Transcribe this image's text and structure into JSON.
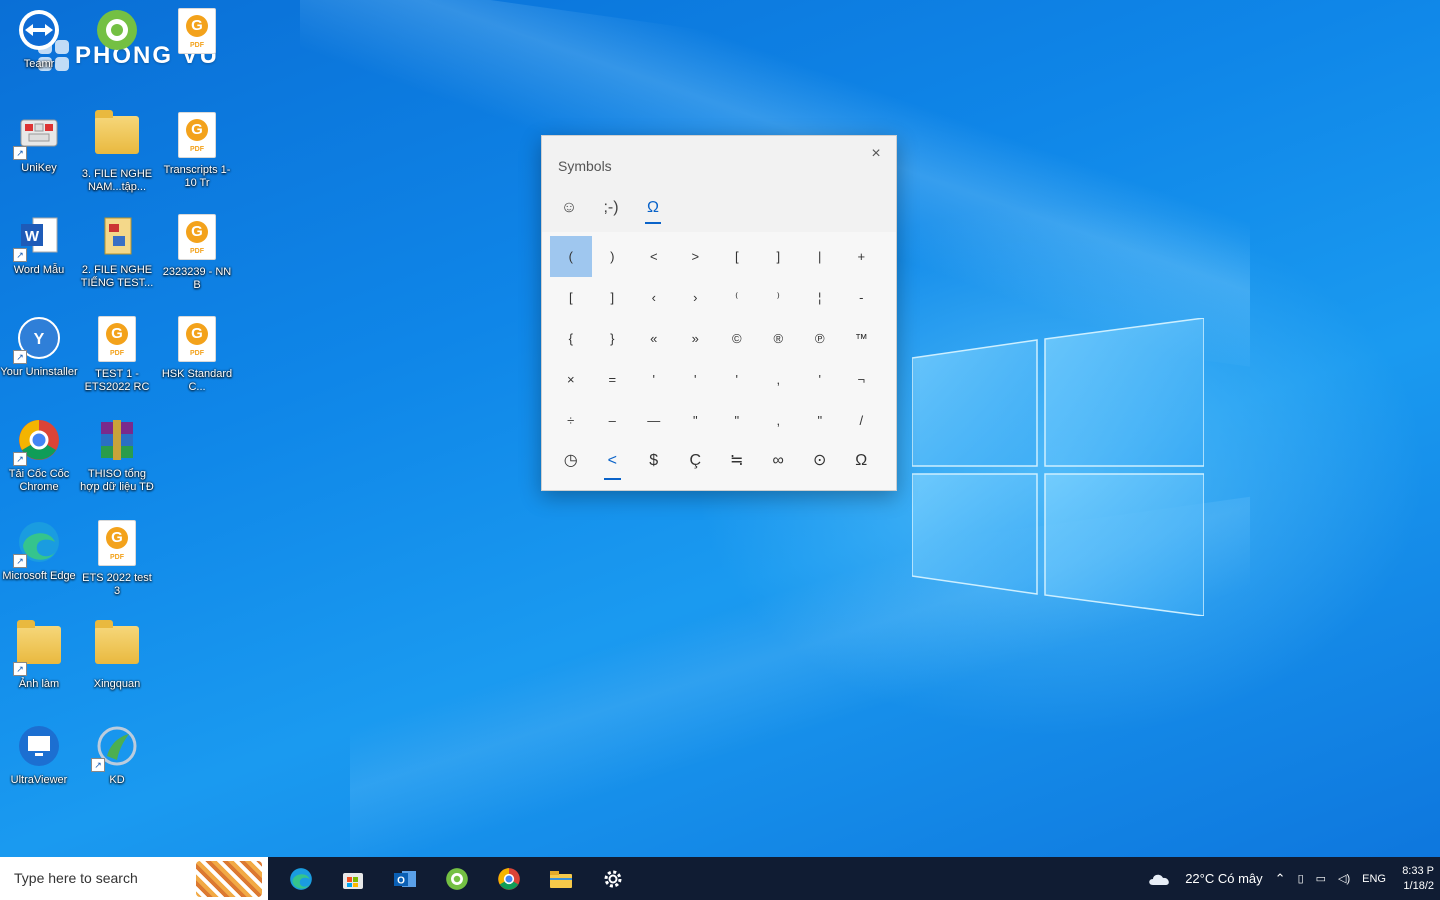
{
  "watermark": {
    "text": "PHONG VU"
  },
  "desktop": {
    "icons": [
      {
        "label": "Teamr"
      },
      {
        "label": ""
      },
      {
        "label": ""
      },
      {
        "label": "UniKey"
      },
      {
        "label": "3. FILE NGHE NAM...tập..."
      },
      {
        "label": "Transcripts 1-10 Tr"
      },
      {
        "label": "Word Mẫu"
      },
      {
        "label": "2. FILE NGHE TIẾNG TEST..."
      },
      {
        "label": "2323239 - NN B"
      },
      {
        "label": "Your Uninstaller"
      },
      {
        "label": "TEST 1 - ETS2022 RC"
      },
      {
        "label": "HSK Standard C..."
      },
      {
        "label": "Tải Cốc Cốc Chrome"
      },
      {
        "label": "THISO tổng hợp dữ liệu TĐ"
      },
      {
        "label": "Microsoft Edge"
      },
      {
        "label": "ETS 2022 test 3"
      },
      {
        "label": "Ảnh làm"
      },
      {
        "label": "Xingquan"
      },
      {
        "label": "UltraViewer"
      },
      {
        "label": "KD"
      }
    ]
  },
  "symbols_panel": {
    "title": "Symbols",
    "close": "×",
    "tabs": [
      "☺",
      ";-)",
      "Ω"
    ],
    "grid": [
      "(",
      ")",
      "<",
      ">",
      "[",
      "]",
      "|",
      "+",
      "[",
      "]",
      "‹",
      "›",
      "⁽",
      "⁾",
      "¦",
      "-",
      "{",
      "}",
      "«",
      "»",
      "©",
      "®",
      "℗",
      "™",
      "×",
      "=",
      "'",
      "'",
      "'",
      ",",
      "'",
      "¬",
      "÷",
      "–",
      "—",
      "\"",
      "\"",
      ",",
      "\"",
      "/"
    ],
    "bottom_tabs": [
      "◷",
      "<",
      "$",
      "Ç",
      "≒",
      "∞",
      "⊙",
      "Ω"
    ]
  },
  "taskbar": {
    "search_placeholder": "Type here to search",
    "weather": "22°C  Có mây",
    "language": "ENG",
    "time": "8:33 P",
    "date": "1/18/2"
  },
  "colors": {
    "desktop_blue": "#0f86e8",
    "accent": "#0a63c9",
    "taskbar": "#101c33"
  }
}
